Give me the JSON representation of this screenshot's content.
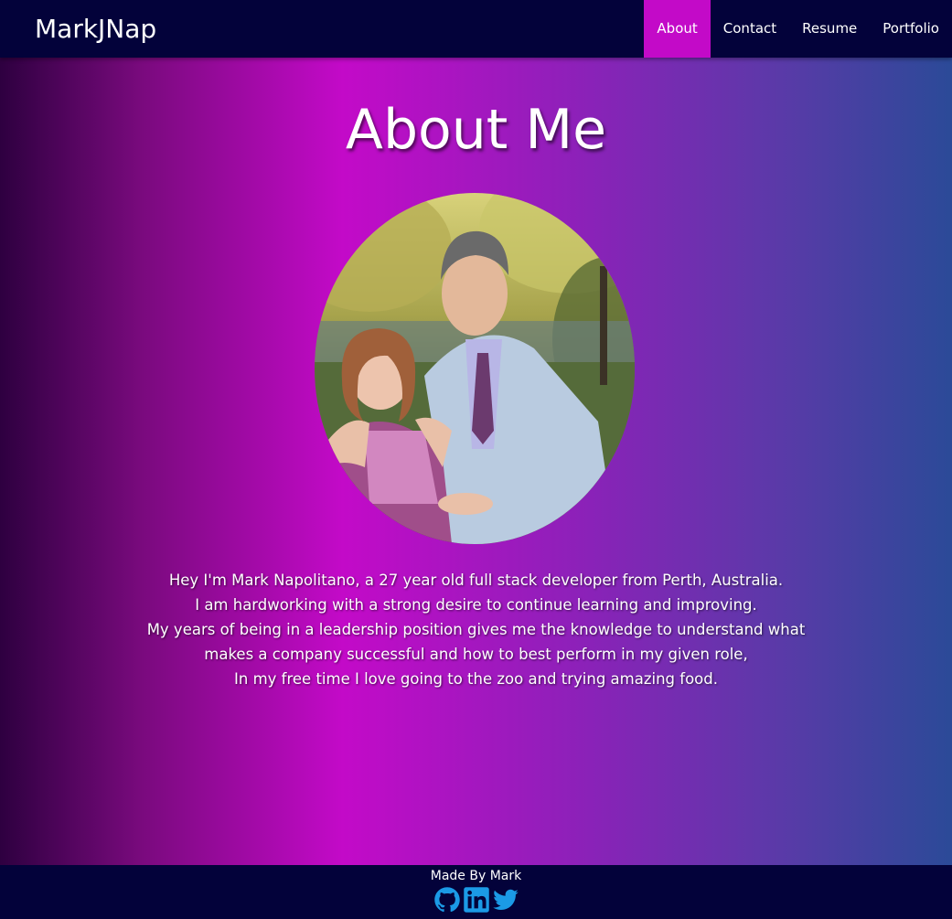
{
  "nav": {
    "brand": "MarkJNap",
    "links": [
      {
        "label": "About",
        "active": true
      },
      {
        "label": "Contact",
        "active": false
      },
      {
        "label": "Resume",
        "active": false
      },
      {
        "label": "Portfolio",
        "active": false
      }
    ]
  },
  "main": {
    "title": "About Me",
    "photo_icon": "profile-photo",
    "bio_lines": [
      "Hey I'm Mark Napolitano, a 27 year old full stack developer from Perth, Australia.",
      "I am hardworking with a strong desire to continue learning and improving.",
      "My years of being in a leadership position gives me the knowledge to understand what",
      "makes a company successful and how to best perform in my given role,",
      "In my free time I love going to the zoo and trying amazing food."
    ]
  },
  "footer": {
    "text": "Made By Mark",
    "icons": [
      "github-icon",
      "linkedin-icon",
      "twitter-icon"
    ]
  },
  "colors": {
    "navbar": "#03023a",
    "accent": "#c30ac8",
    "social_icon": "#1b9ae6"
  }
}
